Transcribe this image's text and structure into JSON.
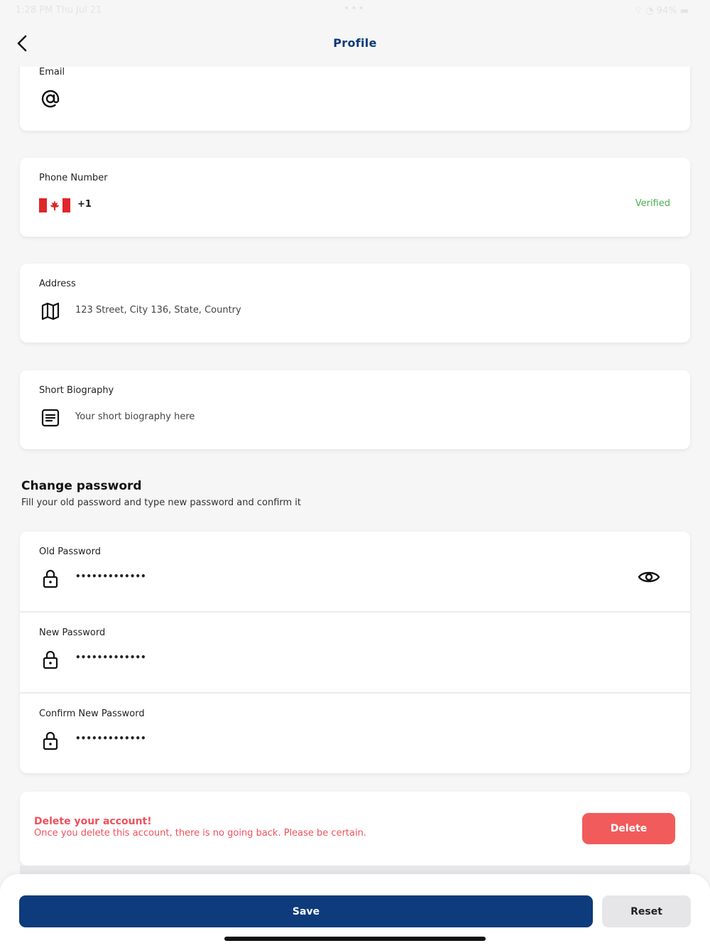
{
  "status_bar": {
    "time": "1:28 PM  Thu Jul 21",
    "dots": "•••",
    "right": "⌔ ◔ 94% ▬"
  },
  "header": {
    "title": "Profile",
    "back_icon": "chevron-left-icon"
  },
  "fields": {
    "email": {
      "label": "Email",
      "icon": "at-sign-icon",
      "value": ""
    },
    "phone": {
      "label": "Phone Number",
      "country": "Canada",
      "dial_code": "+1",
      "status": "Verified",
      "status_color": "#4caf50"
    },
    "address": {
      "label": "Address",
      "icon": "map-icon",
      "value": "123 Street, City 136, State, Country"
    },
    "bio": {
      "label": "Short Biography",
      "icon": "document-icon",
      "value": "Your short biography here"
    }
  },
  "change_password": {
    "title": "Change password",
    "subtitle": "Fill your old password and type new password and confirm it",
    "fields": [
      {
        "label": "Old Password",
        "value": "•••••••••••••",
        "icon": "lock-icon",
        "toggle_icon": "eye-icon"
      },
      {
        "label": "New Password",
        "value": "•••••••••••••",
        "icon": "lock-icon"
      },
      {
        "label": "Confirm New Password",
        "value": "•••••••••••••",
        "icon": "lock-icon"
      }
    ]
  },
  "delete_account": {
    "title": "Delete your account!",
    "subtitle": "Once you delete this account, there is no going back. Please be certain.",
    "button": "Delete",
    "color": "#f25b5b"
  },
  "footer": {
    "save": "Save",
    "reset": "Reset",
    "primary_color": "#0d3b7c"
  }
}
